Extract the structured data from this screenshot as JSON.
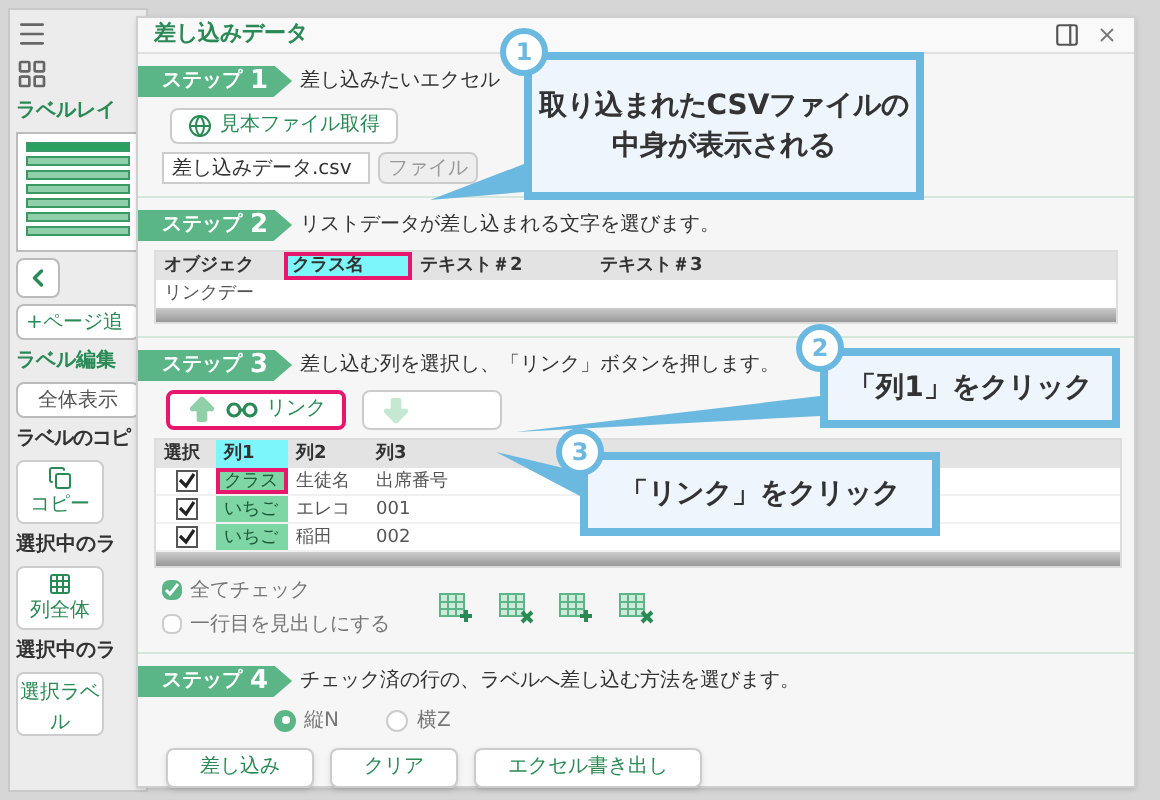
{
  "sidebar": {
    "tab": "ラベルレイ",
    "add_page": "+ページ追",
    "section": "ラベル編集",
    "show_all": "全体表示",
    "copy_heading": "ラベルのコピ",
    "copy_tool": "コピー",
    "selection_heading_1": "選択中のラ",
    "column_tool": "列全体",
    "selection_heading_2": "選択中のラ",
    "label_tool": "選択ラベル"
  },
  "dialog": {
    "title": "差し込みデータ"
  },
  "step1": {
    "badge": "ステップ",
    "number": "1",
    "text": "差し込みたいエクセル",
    "sample_button": "見本ファイル取得",
    "file_field": "差し込みデータ.csv",
    "file_button": "ファイル"
  },
  "step2": {
    "badge": "ステップ",
    "number": "2",
    "text": "リストデータが差し込まれる文字を選びます。",
    "columns": [
      {
        "label": "オブジェク",
        "selected": false,
        "annotated": false
      },
      {
        "label": "クラス名",
        "selected": true,
        "annotated": true
      },
      {
        "label": "テキスト＃2",
        "selected": false,
        "annotated": false
      },
      {
        "label": "テキスト＃3",
        "selected": false,
        "annotated": false
      }
    ],
    "rows": [
      {
        "cells": [
          "リンクデー"
        ]
      }
    ]
  },
  "step3": {
    "badge": "ステップ",
    "number": "3",
    "text": "差し込む列を選択し、「リンク」ボタンを押します。",
    "buttons": [
      {
        "kind": "link",
        "label": "リンク",
        "annotated": true
      },
      {
        "kind": "unlink",
        "annotated": false
      }
    ],
    "select_header": "選択",
    "columns": [
      {
        "label": "列1",
        "selected": true,
        "linked": true
      },
      {
        "label": "列2",
        "selected": false,
        "linked": false
      },
      {
        "label": "列3",
        "selected": false,
        "linked": false
      }
    ],
    "rows": [
      {
        "checked": true,
        "cells": [
          {
            "text": "クラス",
            "annotated": true
          },
          {
            "text": "生徒名",
            "annotated": false
          },
          {
            "text": "出席番号",
            "annotated": false
          }
        ]
      },
      {
        "checked": true,
        "cells": [
          {
            "text": "いちご",
            "annotated": false
          },
          {
            "text": "エレコ",
            "annotated": false
          },
          {
            "text": "001",
            "annotated": false
          }
        ]
      },
      {
        "checked": true,
        "cells": [
          {
            "text": "いちご",
            "annotated": false
          },
          {
            "text": "稲田",
            "annotated": false
          },
          {
            "text": "002",
            "annotated": false
          }
        ]
      }
    ],
    "options": [
      {
        "label": "全てチェック",
        "checked": true
      },
      {
        "label": "一行目を見出しにする",
        "checked": false
      }
    ]
  },
  "step4": {
    "badge": "ステップ",
    "number": "4",
    "text": "チェック済の行の、ラベルへ差し込む方法を選びます。",
    "radios": [
      {
        "label": "縦N",
        "selected": true
      },
      {
        "label": "横Z",
        "selected": false
      }
    ],
    "buttons": [
      "差し込み",
      "クリア",
      "エクセル書き出し"
    ]
  },
  "callouts": [
    {
      "number": "1",
      "lines": [
        "取り込まれたCSVファイルの",
        "中身が表示される"
      ]
    },
    {
      "number": "2",
      "lines": [
        "「列1」をクリック"
      ]
    },
    {
      "number": "3",
      "lines": [
        "「リンク」をクリック"
      ]
    }
  ]
}
